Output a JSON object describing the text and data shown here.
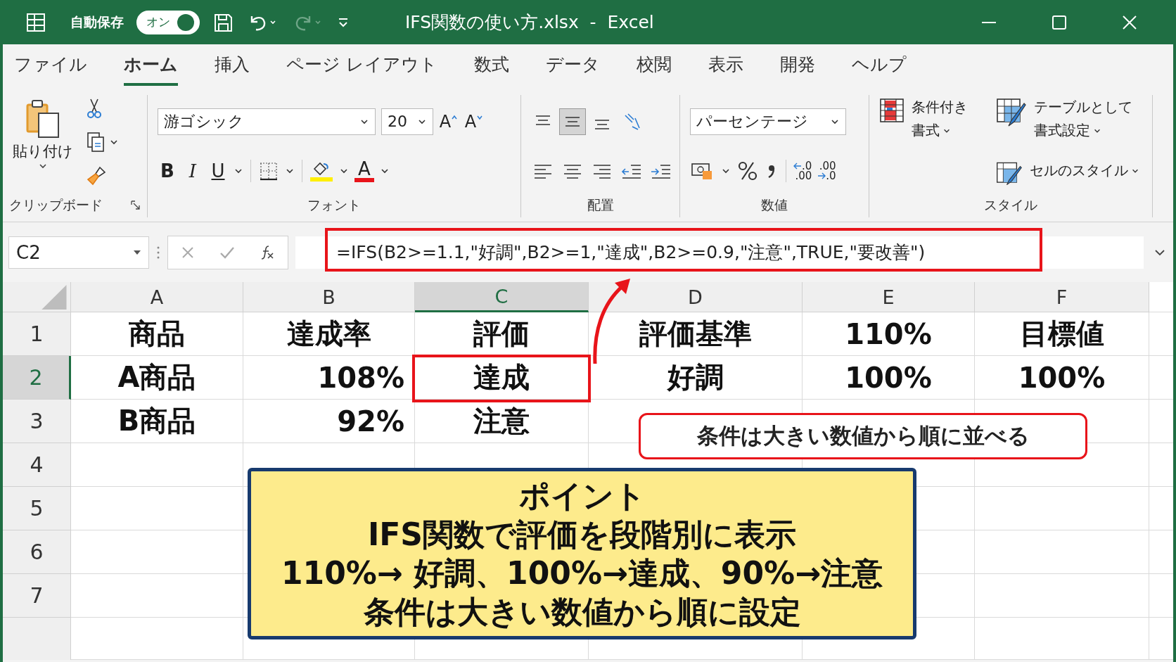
{
  "title_bar": {
    "autosave_label": "自動保存",
    "autosave_toggle": {
      "label": "オン",
      "on": true
    },
    "title": "IFS関数の使い方.xlsx  -  Excel"
  },
  "tabs": [
    {
      "label": "ファイル",
      "selected": false
    },
    {
      "label": "ホーム",
      "selected": true
    },
    {
      "label": "挿入",
      "selected": false
    },
    {
      "label": "ページ レイアウト",
      "selected": false
    },
    {
      "label": "数式",
      "selected": false
    },
    {
      "label": "データ",
      "selected": false
    },
    {
      "label": "校閲",
      "selected": false
    },
    {
      "label": "表示",
      "selected": false
    },
    {
      "label": "開発",
      "selected": false
    },
    {
      "label": "ヘルプ",
      "selected": false
    }
  ],
  "ribbon": {
    "clipboard": {
      "paste": "貼り付け",
      "label": "クリップボード"
    },
    "font": {
      "name": "游ゴシック",
      "size": "20",
      "grow": "A",
      "shrink": "A",
      "bold": "B",
      "italic": "I",
      "underline": "U",
      "font_color": "A",
      "label": "フォント"
    },
    "alignment": {
      "label": "配置"
    },
    "number": {
      "format": "パーセンテージ",
      "increase_decimal": [
        ".0",
        ".00"
      ],
      "decrease_decimal": [
        ".00",
        ".0"
      ],
      "label": "数値"
    },
    "styles": {
      "items": [
        {
          "lines": [
            "条件付き",
            "書式"
          ]
        },
        {
          "lines": [
            "テーブルとして",
            "書式設定"
          ]
        },
        {
          "lines": [
            "セルのスタイル"
          ]
        }
      ],
      "label": "スタイル"
    }
  },
  "formula_bar": {
    "name_box": "C2",
    "formula": "=IFS(B2>=1.1,\"好調\",B2>=1,\"達成\",B2>=0.9,\"注意\",TRUE,\"要改善\")"
  },
  "sheet": {
    "columns": [
      {
        "label": "A",
        "selected": false
      },
      {
        "label": "B",
        "selected": false
      },
      {
        "label": "C",
        "selected": true
      },
      {
        "label": "D",
        "selected": false
      },
      {
        "label": "E",
        "selected": false
      },
      {
        "label": "F",
        "selected": false
      }
    ],
    "rows": [
      {
        "label": "1",
        "selected": false,
        "kind": "header",
        "cells": [
          "商品",
          "達成率",
          "評価",
          "評価基準",
          "110%",
          "目標値"
        ]
      },
      {
        "label": "2",
        "selected": true,
        "kind": "data",
        "cells": [
          "A商品",
          "108%",
          "達成",
          "好調",
          "100%",
          "100%"
        ]
      },
      {
        "label": "3",
        "selected": false,
        "kind": "data",
        "cells": [
          "B商品",
          "92%",
          "注意"
        ]
      },
      {
        "label": "4",
        "selected": false
      },
      {
        "label": "5",
        "selected": false
      },
      {
        "label": "6",
        "selected": false
      },
      {
        "label": "7",
        "selected": false
      }
    ]
  },
  "callout": "条件は大きい数値から順に並べる",
  "point_box": {
    "title": "ポイント",
    "lines": [
      "IFS関数で評価を段階別に表示",
      "110%→ 好調、100%→達成、90%→注意",
      "条件は大きい数値から順に設定"
    ]
  }
}
